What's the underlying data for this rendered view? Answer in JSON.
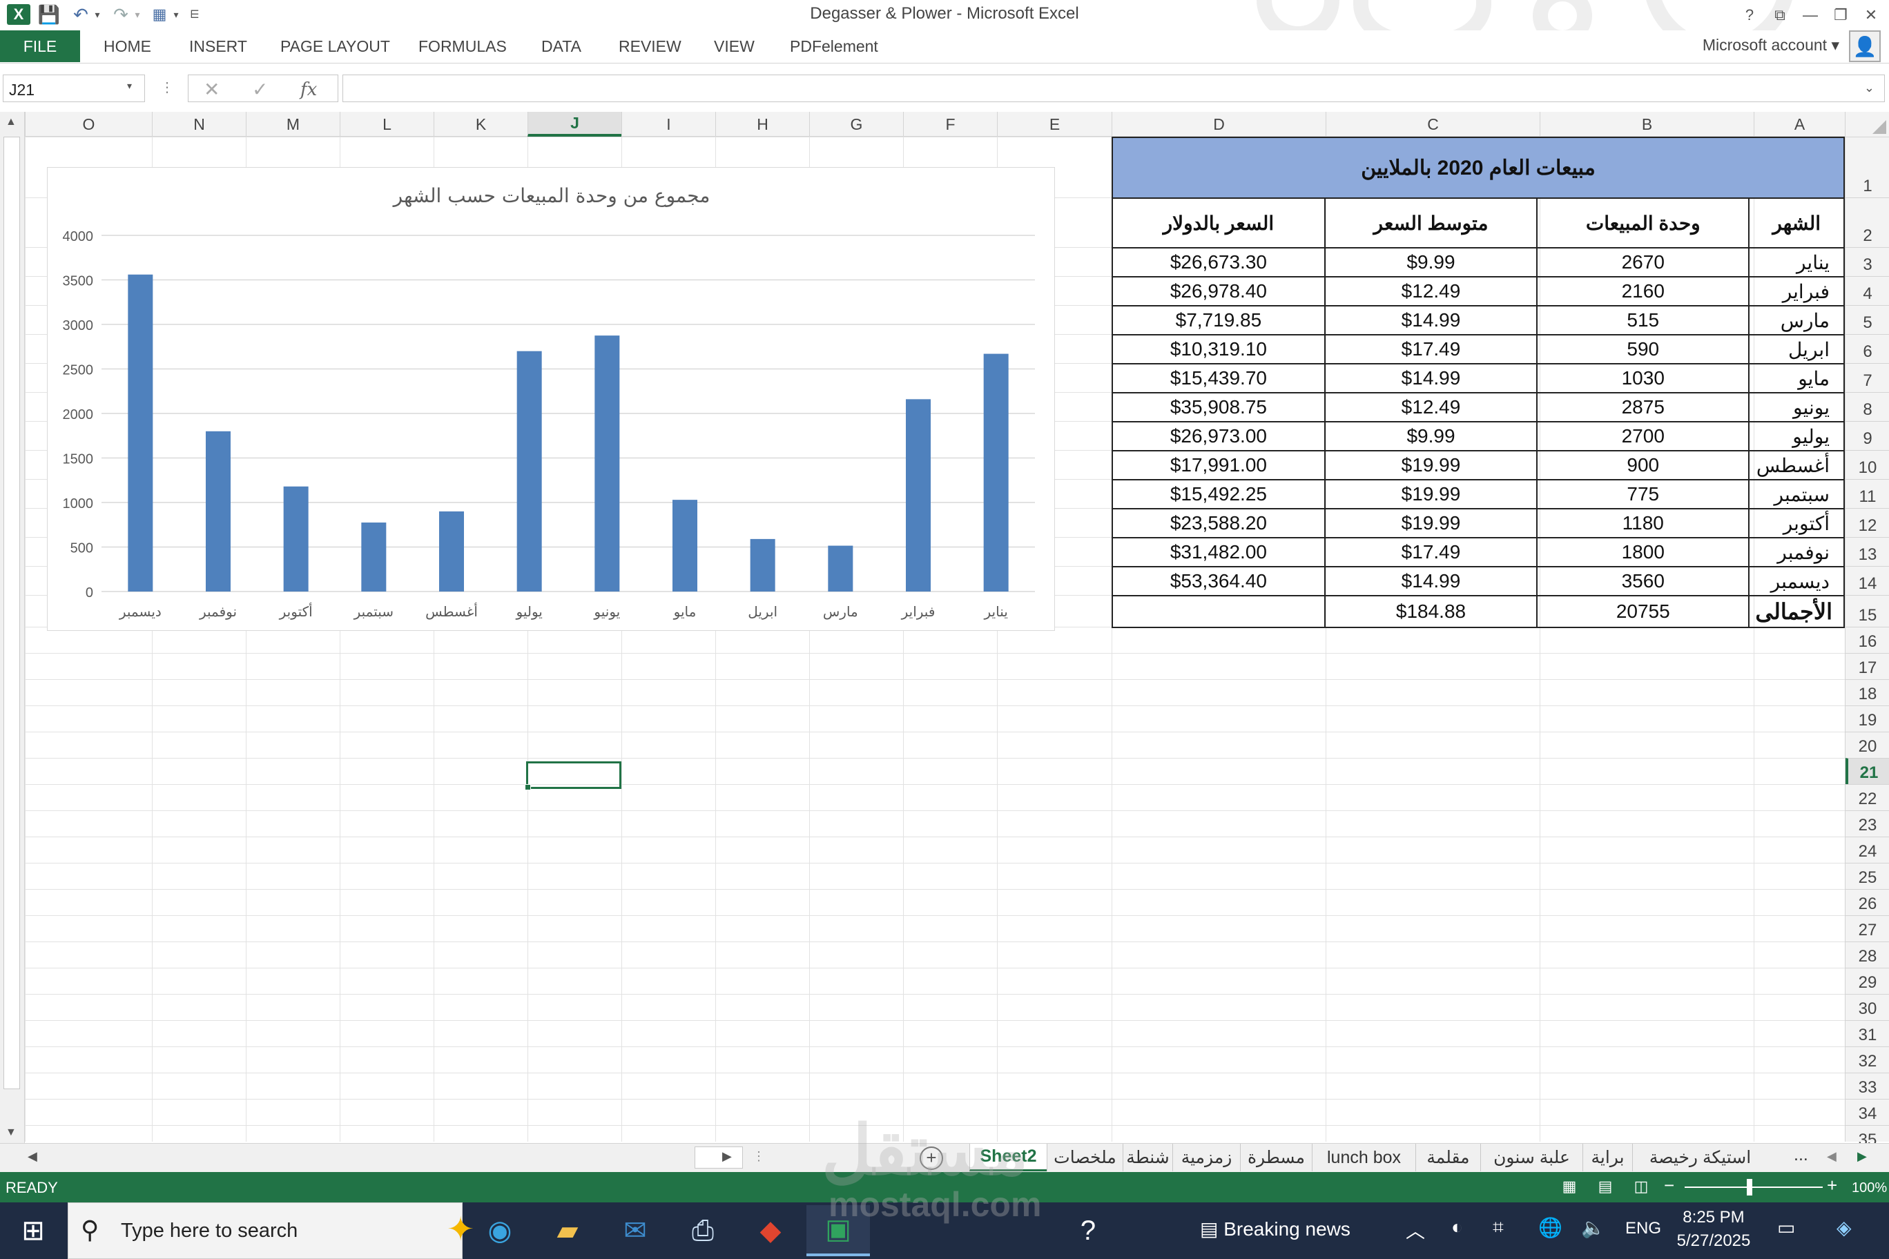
{
  "window": {
    "title": "Degasser & Plower - Microsoft Excel",
    "account": "Microsoft account",
    "account_drop": "▾",
    "help": "?",
    "ribbon_options": "⧉",
    "minimize": "—",
    "restore": "❐",
    "close": "✕"
  },
  "qat": {
    "logo": "X",
    "save": "💾",
    "undo": "↶",
    "redo": "↷",
    "form": "▦",
    "drop": "▾",
    "more": "⋿"
  },
  "ribbon": {
    "tabs": [
      "FILE",
      "HOME",
      "INSERT",
      "PAGE LAYOUT",
      "FORMULAS",
      "DATA",
      "REVIEW",
      "VIEW",
      "PDFelement"
    ]
  },
  "formula_bar": {
    "name_box": "J21",
    "cancel_icon": "✕",
    "enter_icon": "✓",
    "fx_icon": "fx",
    "formula": ""
  },
  "grid": {
    "columns": [
      "O",
      "N",
      "M",
      "L",
      "K",
      "J",
      "I",
      "H",
      "G",
      "F",
      "E",
      "D",
      "C",
      "B",
      "A"
    ],
    "selected_column": "J",
    "rows": [
      "1",
      "2",
      "3",
      "4",
      "5",
      "6",
      "7",
      "8",
      "9",
      "10",
      "11",
      "12",
      "13",
      "14",
      "15",
      "16",
      "17",
      "18",
      "19",
      "20",
      "21",
      "22",
      "23",
      "24",
      "25",
      "26",
      "27",
      "28",
      "29",
      "30",
      "31",
      "32",
      "33",
      "34",
      "35"
    ],
    "selected_row": "21"
  },
  "table": {
    "title": "مبيعات العام 2020 بالملايين",
    "headers": [
      "الشهر",
      "وحدة المبيعات",
      "متوسط السعر",
      "السعر بالدولار"
    ],
    "rows": [
      [
        "يناير",
        "2670",
        "$9.99",
        "$26,673.30"
      ],
      [
        "فبراير",
        "2160",
        "$12.49",
        "$26,978.40"
      ],
      [
        "مارس",
        "515",
        "$14.99",
        "$7,719.85"
      ],
      [
        "ابريل",
        "590",
        "$17.49",
        "$10,319.10"
      ],
      [
        "مايو",
        "1030",
        "$14.99",
        "$15,439.70"
      ],
      [
        "يونيو",
        "2875",
        "$12.49",
        "$35,908.75"
      ],
      [
        "يوليو",
        "2700",
        "$9.99",
        "$26,973.00"
      ],
      [
        "أغسطس",
        "900",
        "$19.99",
        "$17,991.00"
      ],
      [
        "سبتمبر",
        "775",
        "$19.99",
        "$15,492.25"
      ],
      [
        "أكتوبر",
        "1180",
        "$19.99",
        "$23,588.20"
      ],
      [
        "نوفمبر",
        "1800",
        "$17.49",
        "$31,482.00"
      ],
      [
        "ديسمبر",
        "3560",
        "$14.99",
        "$53,364.40"
      ]
    ],
    "total": {
      "label": "الأجمالى",
      "units": "20755",
      "avg_price": "$184.88",
      "dollars": ""
    }
  },
  "chart_data": {
    "type": "bar",
    "title": "مجموع من وحدة المبيعات حسب الشهر",
    "categories": [
      "يناير",
      "فبراير",
      "مارس",
      "ابريل",
      "مايو",
      "يونيو",
      "يوليو",
      "أغسطس",
      "سبتمبر",
      "أكتوبر",
      "نوفمبر",
      "ديسمبر"
    ],
    "values": [
      2670,
      2160,
      515,
      590,
      1030,
      2875,
      2700,
      900,
      775,
      1180,
      1800,
      3560
    ],
    "ylim": [
      0,
      4000
    ],
    "yticks": [
      0,
      500,
      1000,
      1500,
      2000,
      2500,
      3000,
      3500,
      4000
    ],
    "xlabel": "",
    "ylabel": "",
    "grid": true,
    "bar_color": "#4f81bd",
    "x_direction": "right-to-left"
  },
  "sheets": {
    "active": "Sheet2",
    "tabs": [
      "Sheet2",
      "ملخصات",
      "شنطة",
      "زمزمية",
      "مسطرة",
      "lunch box",
      "مقلمة",
      "علبة سنون",
      "براية",
      "استيكة رخيصة"
    ],
    "more": "..."
  },
  "status": {
    "text": "READY",
    "zoom": "100%",
    "zoom_fraction": 0.5
  },
  "taskbar": {
    "search_placeholder": "Type here to search",
    "news": "Breaking news",
    "language": "ENG",
    "time": "8:25 PM",
    "date": "5/27/2025"
  },
  "watermark": {
    "text": "مستقل",
    "sub": "mostaql.com"
  },
  "colors": {
    "excel_green": "#217346",
    "table_title_bg": "#8eaadb",
    "taskbar_bg": "#1f2c43"
  }
}
